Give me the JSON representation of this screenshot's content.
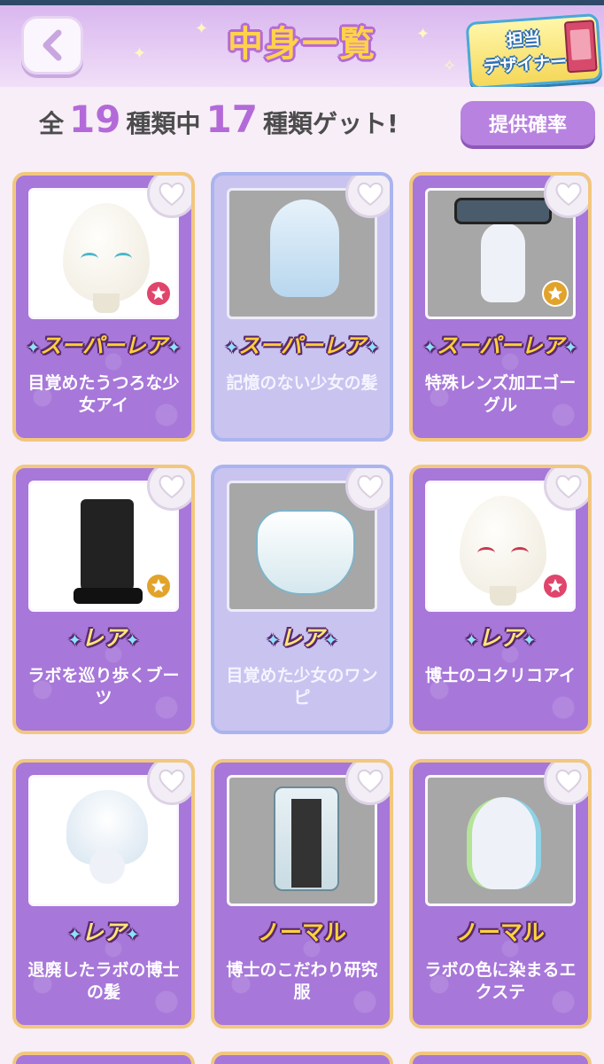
{
  "header": {
    "title": "中身一覧",
    "designer_line1": "担当",
    "designer_line2": "デザイナー"
  },
  "summary": {
    "prefix": "全",
    "total": "19",
    "mid": "種類中",
    "owned": "17",
    "suffix": "種類ゲット!"
  },
  "rate_button": "提供確率",
  "items": [
    {
      "rarity": "スーパーレア",
      "name": "目覚めたうつろな少女アイ",
      "status": "owned",
      "badge": "red"
    },
    {
      "rarity": "スーパーレア",
      "name": "記憶のない少女の髪",
      "status": "faded",
      "badge": ""
    },
    {
      "rarity": "スーパーレア",
      "name": "特殊レンズ加工ゴーグル",
      "status": "owned",
      "badge": "gold"
    },
    {
      "rarity": "レア",
      "name": "ラボを巡り歩くブーツ",
      "status": "owned",
      "badge": "gold"
    },
    {
      "rarity": "レア",
      "name": "目覚めた少女のワンピ",
      "status": "faded",
      "badge": ""
    },
    {
      "rarity": "レア",
      "name": "博士のコクリコアイ",
      "status": "owned",
      "badge": "red"
    },
    {
      "rarity": "レア",
      "name": "退廃したラボの博士の髪",
      "status": "owned",
      "badge": ""
    },
    {
      "rarity": "ノーマル",
      "name": "博士のこだわり研究服",
      "status": "owned",
      "badge": ""
    },
    {
      "rarity": "ノーマル",
      "name": "ラボの色に染まるエクステ",
      "status": "owned",
      "badge": ""
    }
  ],
  "icons": {
    "back": "chevron-left-icon",
    "favorite": "heart-icon",
    "badge": "star-icon"
  },
  "colors": {
    "accent": "#b36ad8",
    "card": "#a777d9",
    "card_border": "#f2c77e",
    "title": "#ffd24a"
  }
}
